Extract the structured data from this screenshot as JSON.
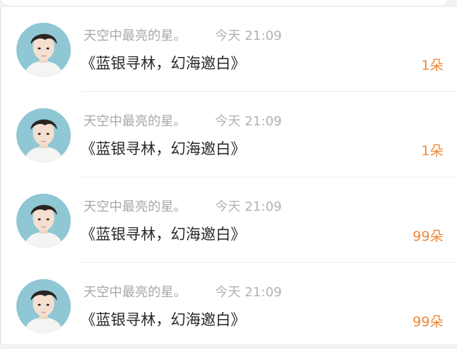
{
  "items": [
    {
      "nickname": "天空中最亮的星。",
      "time": "今天 21:09",
      "title": "《蓝银寻林，幻海邀白》",
      "count": "1朵"
    },
    {
      "nickname": "天空中最亮的星。",
      "time": "今天 21:09",
      "title": "《蓝银寻林，幻海邀白》",
      "count": "1朵"
    },
    {
      "nickname": "天空中最亮的星。",
      "time": "今天 21:09",
      "title": "《蓝银寻林，幻海邀白》",
      "count": "99朵"
    },
    {
      "nickname": "天空中最亮的星。",
      "time": "今天 21:09",
      "title": "《蓝银寻林，幻海邀白》",
      "count": "99朵"
    }
  ],
  "colors": {
    "count_accent": "#f0883a",
    "meta_text": "#a8a8a8",
    "title_text": "#2a2a2a",
    "avatar_bg": "#8fc7d4"
  }
}
